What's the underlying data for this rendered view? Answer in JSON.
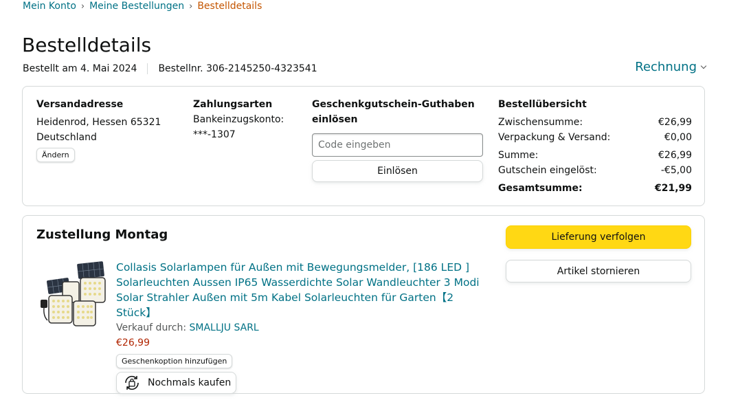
{
  "breadcrumb": {
    "items": [
      "Mein Konto",
      "Meine Bestellungen"
    ],
    "separator": "›",
    "current": "Bestelldetails"
  },
  "page": {
    "title": "Bestelldetails",
    "ordered_on": "Bestellt am 4. Mai 2024",
    "order_number": "Bestellnr. 306-2145250-4323541",
    "invoice_label": "Rechnung"
  },
  "shipping": {
    "heading": "Versandadresse",
    "line1": "Heidenrod, Hessen 65321",
    "line2": "Deutschland",
    "change_label": "Ändern"
  },
  "payment": {
    "heading": "Zahlungsarten",
    "method": "Bankeinzugskonto:",
    "account": "***-1307"
  },
  "gift_card": {
    "heading_line1": "Geschenkgutschein-Guthaben",
    "heading_line2": "einlösen",
    "placeholder": "Code eingeben",
    "redeem_label": "Einlösen"
  },
  "summary": {
    "heading": "Bestellübersicht",
    "rows": [
      {
        "label": "Zwischensumme:",
        "value": "€26,99"
      },
      {
        "label": "Verpackung & Versand:",
        "value": "€0,00"
      },
      {
        "label": "Summe:",
        "value": "€26,99"
      },
      {
        "label": "Gutschein eingelöst:",
        "value": "-€5,00"
      }
    ],
    "total_label": "Gesamtsumme:",
    "total_value": "€21,99"
  },
  "delivery": {
    "title": "Zustellung Montag",
    "track_label": "Lieferung verfolgen",
    "cancel_label": "Artikel stornieren"
  },
  "product": {
    "title_line1": "Collasis Solarlampen für Außen mit Bewegungsmelder, [186 LED ]",
    "title_line2": "Solarleuchten Aussen IP65 Wasserdichte Solar Wandleuchter 3 Modi",
    "title_line3": "Solar Strahler Außen mit 5m Kabel Solarleuchten für Garten【2 Stück】",
    "seller_prefix": "Verkauf durch: ",
    "seller_name": "SMALLJU SARL",
    "price": "€26,99",
    "gift_option_label": "Geschenkoption hinzufügen",
    "buy_again_label": "Nochmals kaufen"
  },
  "colors": {
    "link": "#007185",
    "accent_orange": "#c45500",
    "price_red": "#b12704",
    "track_button": "#ffd814",
    "border": "#d5d9d9"
  },
  "icons": {
    "invoice": "chevron-down-icon",
    "buy_again": "buy-again-icon",
    "product": "product-thumbnail"
  }
}
